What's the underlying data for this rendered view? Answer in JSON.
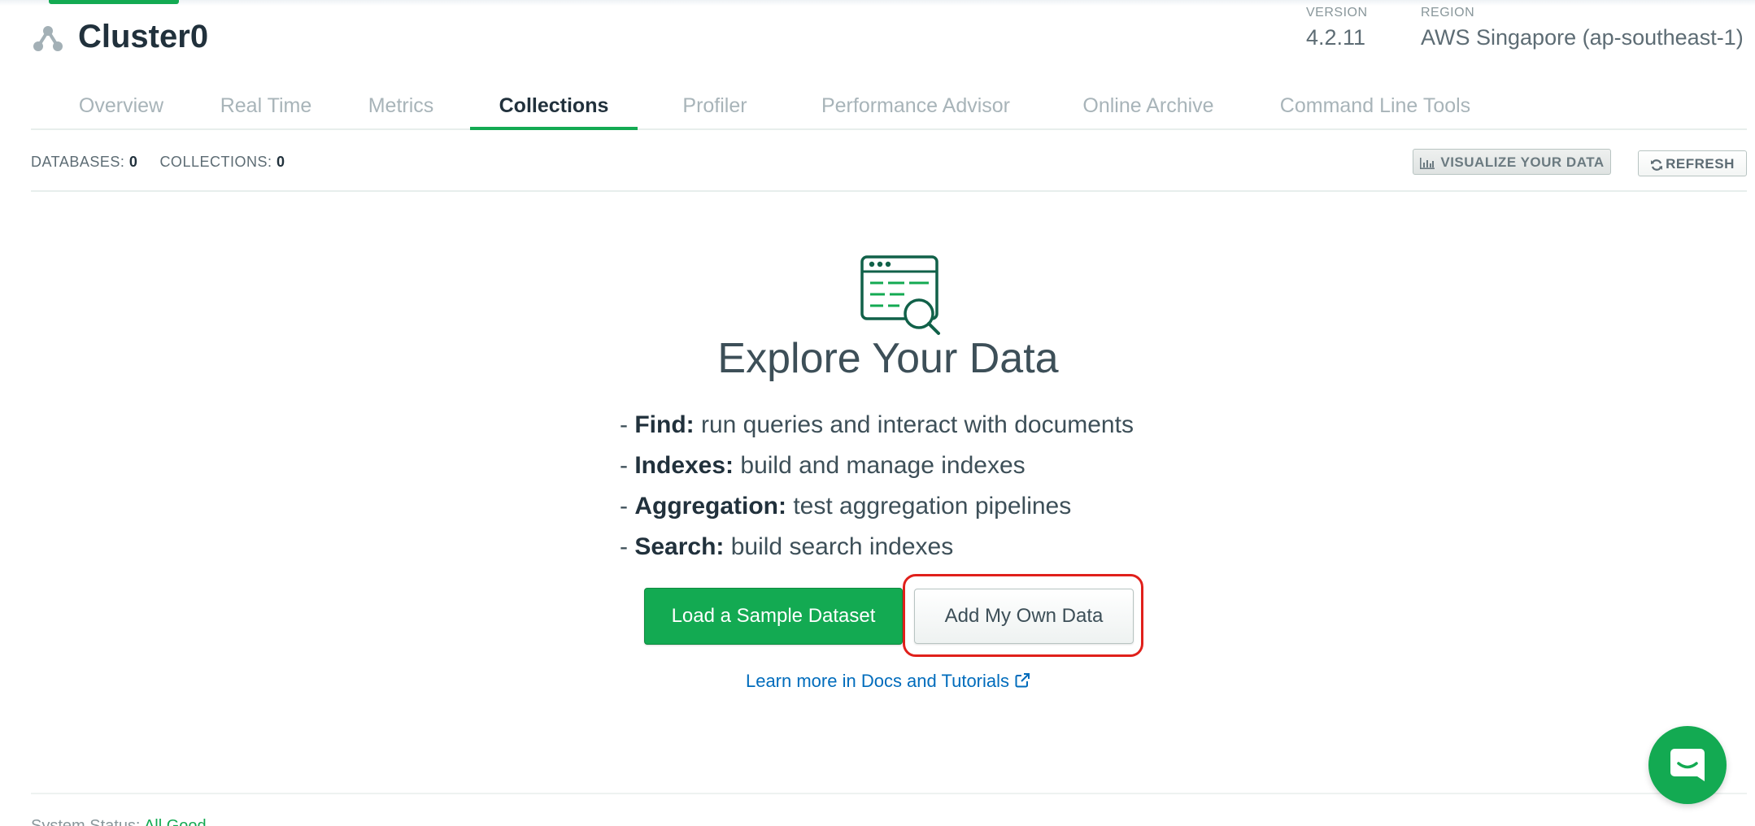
{
  "header": {
    "cluster_name": "Cluster0",
    "version_label": "VERSION",
    "version_value": "4.2.11",
    "region_label": "REGION",
    "region_value": "AWS Singapore (ap-southeast-1)"
  },
  "tabs": [
    {
      "label": "Overview"
    },
    {
      "label": "Real Time"
    },
    {
      "label": "Metrics"
    },
    {
      "label": "Collections"
    },
    {
      "label": "Profiler"
    },
    {
      "label": "Performance Advisor"
    },
    {
      "label": "Online Archive"
    },
    {
      "label": "Command Line Tools"
    }
  ],
  "active_tab": "Collections",
  "counts": {
    "databases_label": "DATABASES:",
    "databases_value": "0",
    "collections_label": "COLLECTIONS:",
    "collections_value": "0"
  },
  "toolbar": {
    "visualize_label": "VISUALIZE YOUR DATA",
    "refresh_label": "REFRESH"
  },
  "main": {
    "title": "Explore Your Data",
    "features": [
      {
        "name": "Find:",
        "desc": "run queries and interact with documents"
      },
      {
        "name": "Indexes:",
        "desc": "build and manage indexes"
      },
      {
        "name": "Aggregation:",
        "desc": "test aggregation pipelines"
      },
      {
        "name": "Search:",
        "desc": "build search indexes"
      }
    ],
    "load_sample_label": "Load a Sample Dataset",
    "add_own_label": "Add My Own Data",
    "learn_more_label": "Learn more in Docs and Tutorials"
  },
  "footer": {
    "status_label": "System Status:",
    "status_value": "All Good"
  },
  "icons": {
    "cluster": "cluster-icon",
    "chart": "bar-chart-icon",
    "refresh": "refresh-icon",
    "explore": "data-explorer-icon",
    "external": "external-link-icon",
    "chat": "chat-icon"
  },
  "colors": {
    "accent_green": "#13aa52",
    "link_blue": "#006cbc",
    "highlight_red": "#e0201b",
    "text_dark": "#21313c"
  }
}
